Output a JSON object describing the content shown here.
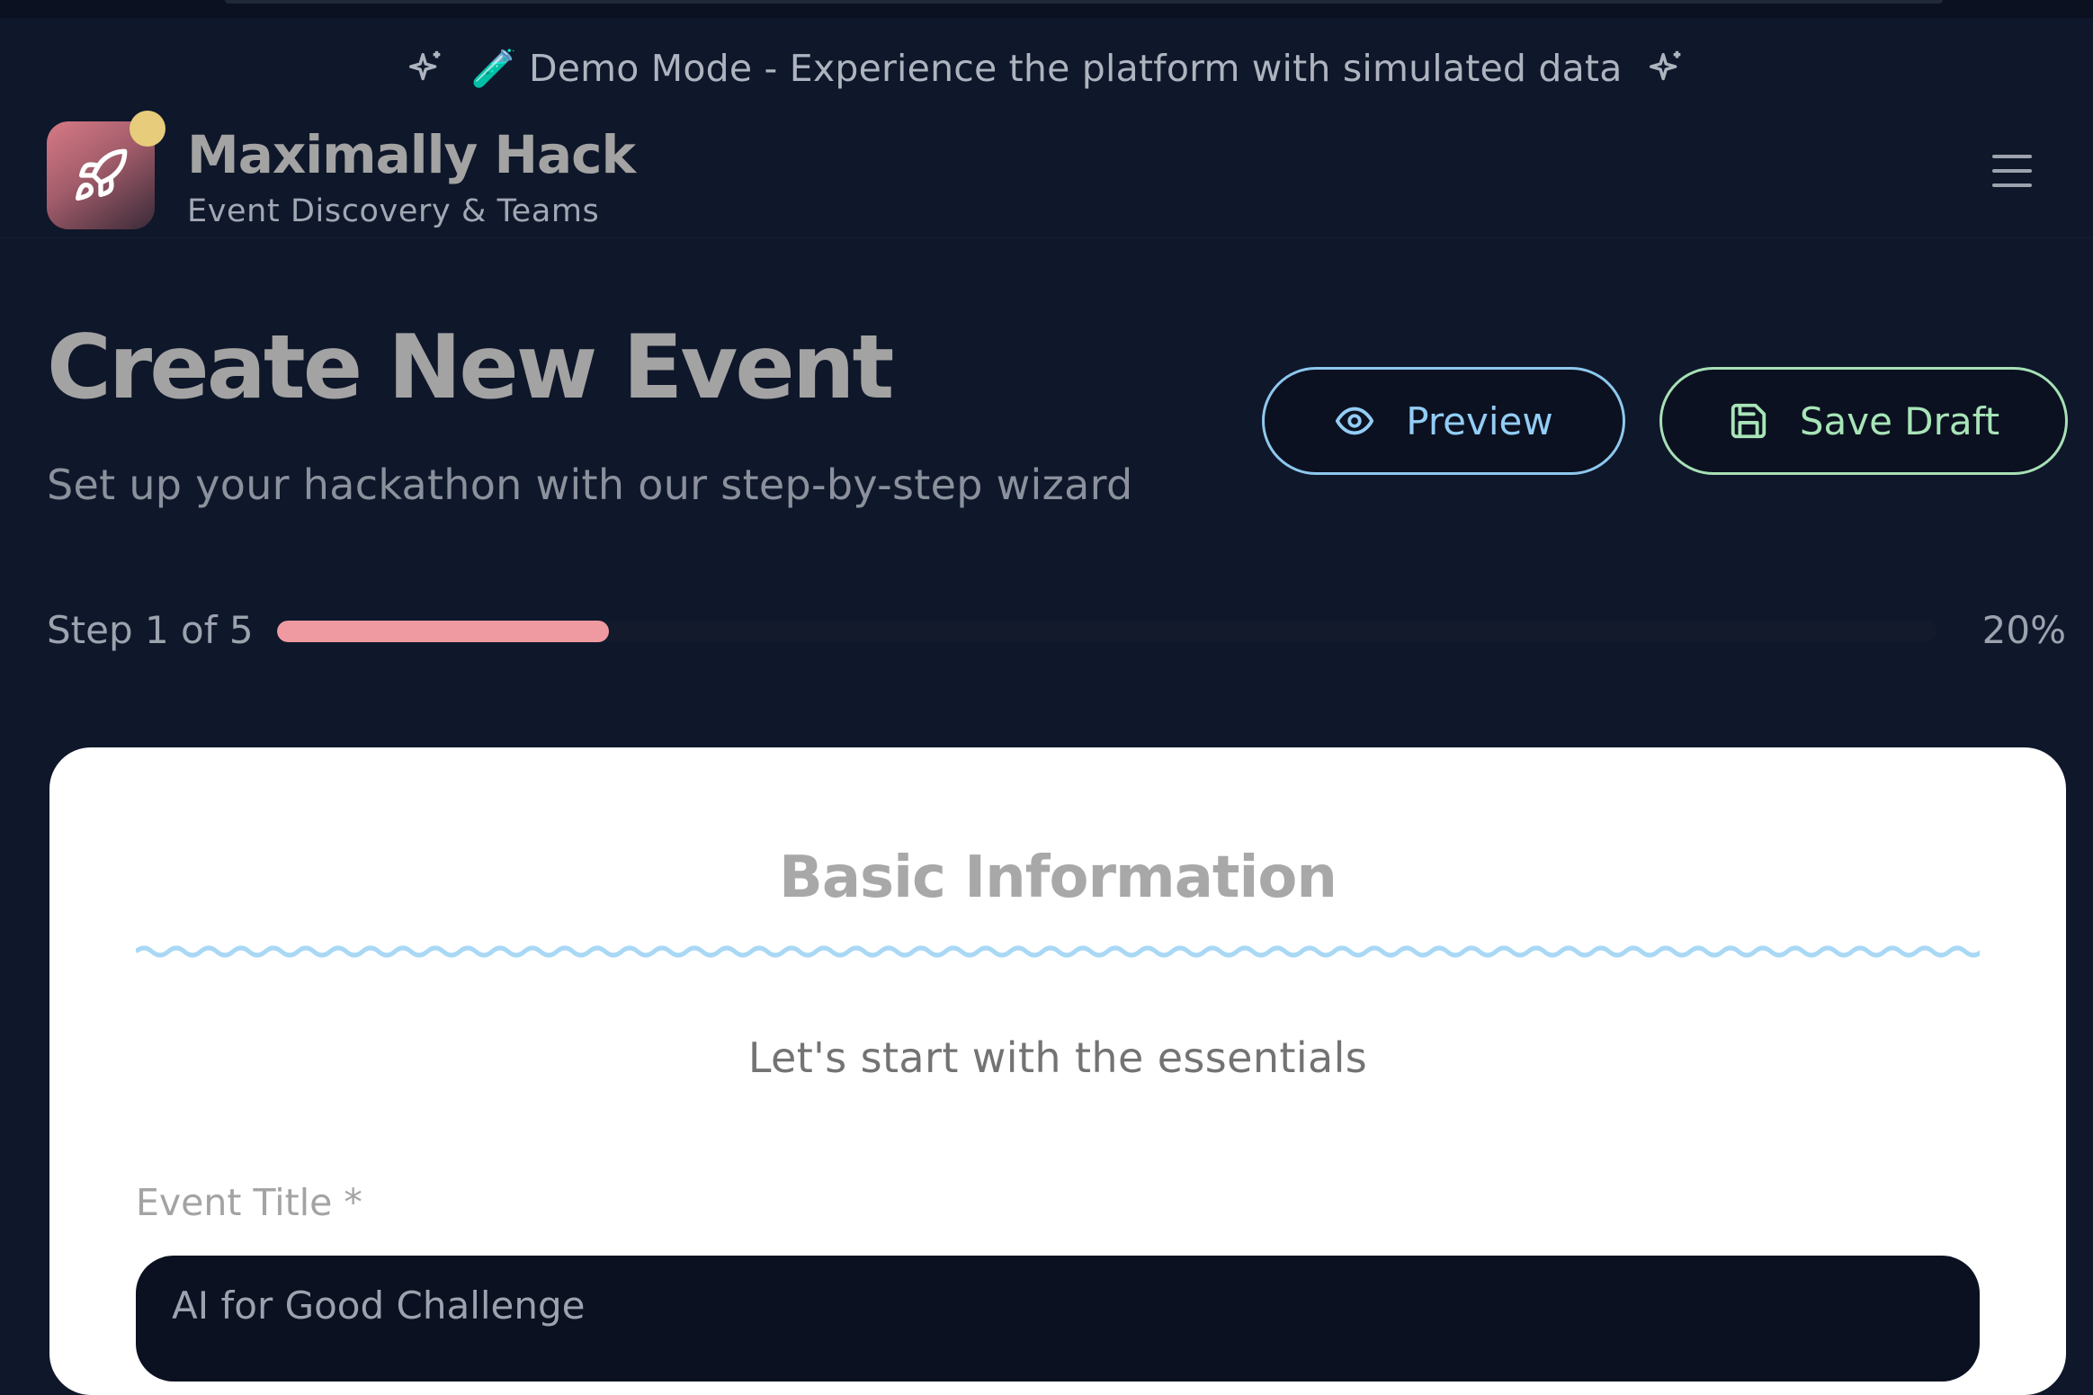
{
  "banner": {
    "emoji": "🧪",
    "text": "Demo Mode - Experience the platform with simulated data",
    "icons": [
      "sparkles-icon",
      "test-tube-icon",
      "sparkles-icon"
    ]
  },
  "header": {
    "brand_title": "Maximally Hack",
    "brand_subtitle": "Event Discovery & Teams",
    "logo_icon": "rocket-icon",
    "menu_icon": "hamburger-menu-icon"
  },
  "page": {
    "title": "Create New Event",
    "subtitle": "Set up your hackathon with our step-by-step wizard"
  },
  "actions": {
    "preview_label": "Preview",
    "save_draft_label": "Save Draft",
    "preview_icon": "eye-icon",
    "save_icon": "save-icon"
  },
  "progress": {
    "step_label": "Step 1 of 5",
    "percent_label": "20%",
    "fraction": 0.2
  },
  "form": {
    "section_title": "Basic Information",
    "section_subtitle": "Let's start with the essentials",
    "event_title_label": "Event Title *",
    "event_title_value": "AI for Good Challenge"
  },
  "colors": {
    "background": "#0f172a",
    "progress_fill": "#ee9aa0",
    "preview_accent": "#93cdf5",
    "save_accent": "#a8e4b8",
    "wavy_divider": "#a9d8f5",
    "logo_dot": "#e6cc7b"
  }
}
